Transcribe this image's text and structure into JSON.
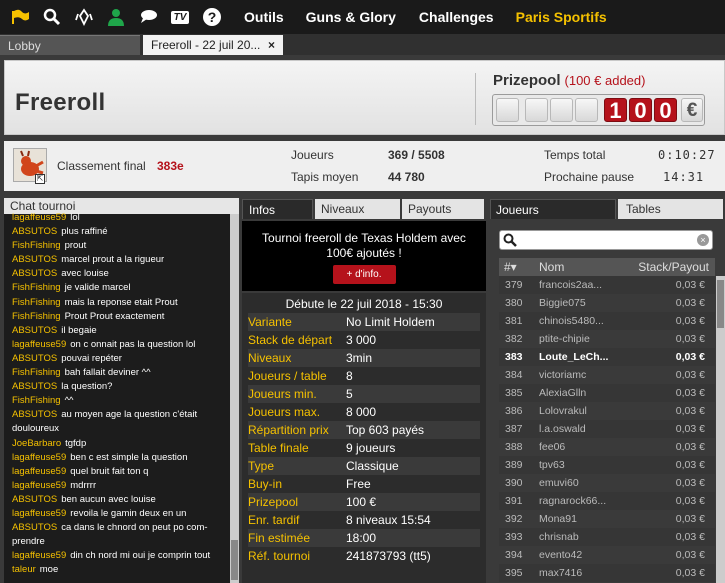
{
  "topnav": {
    "icons": [
      "flag-icon",
      "search-icon",
      "cards-icon",
      "user-icon",
      "chat-bubbles-icon",
      "tv-icon",
      "help-icon"
    ],
    "tv_label": "TV",
    "help_label": "?",
    "links": [
      "Outils",
      "Guns & Glory",
      "Challenges",
      "Paris Sportifs"
    ],
    "active_link": "Paris Sportifs"
  },
  "tabs": {
    "lobby": "Lobby",
    "active": "Freeroll - 22 juil 20...",
    "close": "×"
  },
  "header": {
    "title": "Freeroll",
    "prizepool_label": "Prizepool",
    "prizepool_added": "(100 € added)",
    "prizepool_digits": [
      "",
      "",
      "",
      "",
      "1",
      "0",
      "0"
    ],
    "currency": "€"
  },
  "info": {
    "rank_label": "Classement final",
    "rank_value": "383e",
    "players_label": "Joueurs",
    "players_value": "369 / 5508",
    "avg_stack_label": "Tapis moyen",
    "avg_stack_value": "44 780",
    "total_time_label": "Temps total",
    "total_time_value": "0:10:27",
    "next_break_label": "Prochaine pause",
    "next_break_value": "14:31"
  },
  "chat": {
    "title": "Chat tournoi",
    "messages": [
      {
        "user": "lagaffeuse59",
        "text": "lol"
      },
      {
        "user": "ABSUTOS",
        "text": "plus raffiné"
      },
      {
        "user": "FishFishing",
        "text": "prout"
      },
      {
        "user": "ABSUTOS",
        "text": "marcel prout a la rigueur"
      },
      {
        "user": "ABSUTOS",
        "text": "avec louise"
      },
      {
        "user": "FishFishing",
        "text": "je valide marcel"
      },
      {
        "user": "FishFishing",
        "text": "mais la reponse etait Prout"
      },
      {
        "user": "FishFishing",
        "text": "Prout Prout exactement"
      },
      {
        "user": "ABSUTOS",
        "text": "il begaie"
      },
      {
        "user": "lagaffeuse59",
        "text": "on c onnait pas la question lol"
      },
      {
        "user": "ABSUTOS",
        "text": "pouvai repéter"
      },
      {
        "user": "FishFishing",
        "text": "bah fallait deviner ^^"
      },
      {
        "user": "ABSUTOS",
        "text": "la question?"
      },
      {
        "user": "FishFishing",
        "text": "^^"
      },
      {
        "user": "ABSUTOS",
        "text": "au moyen age la question c'était"
      },
      {
        "user": "",
        "text": "douloureux"
      },
      {
        "user": "JoeBarbaro",
        "text": "tgfdp"
      },
      {
        "user": "lagaffeuse59",
        "text": "ben c est simple la question"
      },
      {
        "user": "lagaffeuse59",
        "text": "quel bruit fait ton q"
      },
      {
        "user": "lagaffeuse59",
        "text": "mdrrrr"
      },
      {
        "user": "ABSUTOS",
        "text": "ben aucun avec louise"
      },
      {
        "user": "lagaffeuse59",
        "text": "revoila le gamin deux en un"
      },
      {
        "user": "ABSUTOS",
        "text": "ca dans le chnord on peut po com-"
      },
      {
        "user": "",
        "text": "prendre"
      },
      {
        "user": "lagaffeuse59",
        "text": "din ch nord mi oui je comprin tout"
      },
      {
        "user": "taleur",
        "text": "moe"
      }
    ]
  },
  "infos": {
    "tabs": [
      "Infos",
      "Niveaux",
      "Payouts"
    ],
    "promo_text": "Tournoi freeroll de Texas Holdem avec 100€ ajoutés !",
    "promo_button": "+ d'info.",
    "start_date": "Débute le 22 juil 2018 - 15:30",
    "rows": [
      {
        "k": "Variante",
        "v": "No Limit Holdem"
      },
      {
        "k": "Stack de départ",
        "v": "3 000"
      },
      {
        "k": "Niveaux",
        "v": "3min"
      },
      {
        "k": "Joueurs / table",
        "v": "8"
      },
      {
        "k": "Joueurs min.",
        "v": "5"
      },
      {
        "k": "Joueurs max.",
        "v": "8 000"
      },
      {
        "k": "Répartition prix",
        "v": "Top 603 payés"
      },
      {
        "k": "Table finale",
        "v": "9 joueurs"
      },
      {
        "k": "Type",
        "v": "Classique"
      },
      {
        "k": "Buy-in",
        "v": "Free"
      },
      {
        "k": "Prizepool",
        "v": "100 €"
      },
      {
        "k": "Enr. tardif",
        "v": "8 niveaux 15:54"
      },
      {
        "k": "Fin estimée",
        "v": "18:00"
      },
      {
        "k": "Réf. tournoi",
        "v": "241873793 (tt5)"
      }
    ]
  },
  "players": {
    "tabs": [
      "Joueurs",
      "Tables"
    ],
    "search_placeholder": "",
    "clear": "×",
    "columns": [
      "#▾",
      "Nom",
      "Stack/Payout"
    ],
    "rows": [
      {
        "n": "379",
        "name": "francois2aa...",
        "s": "0,03 €"
      },
      {
        "n": "380",
        "name": "Biggie075",
        "s": "0,03 €"
      },
      {
        "n": "381",
        "name": "chinois5480...",
        "s": "0,03 €"
      },
      {
        "n": "382",
        "name": "ptite-chipie",
        "s": "0,03 €"
      },
      {
        "n": "383",
        "name": "Loute_LeCh...",
        "s": "0,03 €",
        "me": true
      },
      {
        "n": "384",
        "name": "victoriamc",
        "s": "0,03 €"
      },
      {
        "n": "385",
        "name": "AlexiaGlln",
        "s": "0,03 €"
      },
      {
        "n": "386",
        "name": "Lolovrakul",
        "s": "0,03 €"
      },
      {
        "n": "387",
        "name": "l.a.oswald",
        "s": "0,03 €"
      },
      {
        "n": "388",
        "name": "fee06",
        "s": "0,03 €"
      },
      {
        "n": "389",
        "name": "tpv63",
        "s": "0,03 €"
      },
      {
        "n": "390",
        "name": "emuvi60",
        "s": "0,03 €"
      },
      {
        "n": "391",
        "name": "ragnarock66...",
        "s": "0,03 €"
      },
      {
        "n": "392",
        "name": "Mona91",
        "s": "0,03 €"
      },
      {
        "n": "393",
        "name": "chrisnab",
        "s": "0,03 €"
      },
      {
        "n": "394",
        "name": "evento42",
        "s": "0,03 €"
      },
      {
        "n": "395",
        "name": "max7416",
        "s": "0,03 €"
      }
    ]
  },
  "colors": {
    "accent": "#f5c100",
    "red": "#b5121b",
    "dark": "#2a2a2a"
  }
}
